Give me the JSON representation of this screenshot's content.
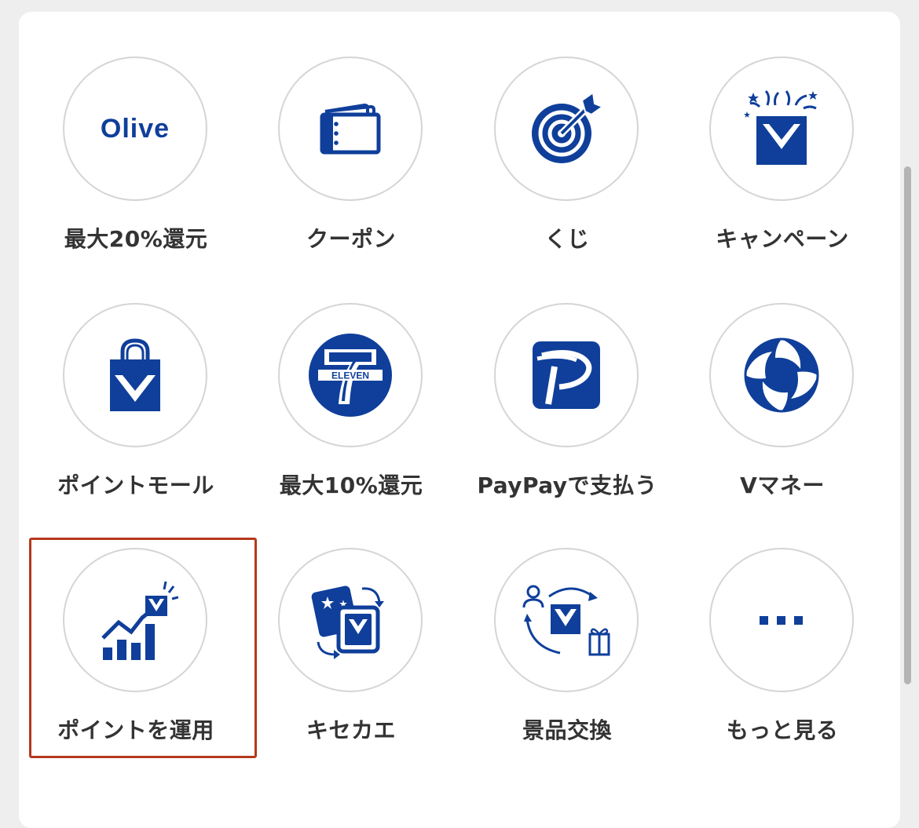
{
  "accent_color": "#0f3f9a",
  "highlight_color": "#b5381b",
  "menu": {
    "items": [
      {
        "label": "最大20%還元",
        "icon": "olive-logo-icon",
        "icon_text": "Olive"
      },
      {
        "label": "クーポン",
        "icon": "coupon-book-icon"
      },
      {
        "label": "くじ",
        "icon": "target-icon"
      },
      {
        "label": "キャンペーン",
        "icon": "celebration-envelope-icon"
      },
      {
        "label": "ポイントモール",
        "icon": "shopping-bag-icon"
      },
      {
        "label": "最大10%還元",
        "icon": "seven-eleven-icon",
        "icon_text": "ELEVEN"
      },
      {
        "label": "PayPayで支払う",
        "icon": "paypay-icon"
      },
      {
        "label": "Vマネー",
        "icon": "vmoney-icon"
      },
      {
        "label": "ポイントを運用",
        "icon": "investment-chart-icon",
        "selected": true
      },
      {
        "label": "キセカエ",
        "icon": "theme-cards-icon"
      },
      {
        "label": "景品交換",
        "icon": "prize-exchange-icon"
      },
      {
        "label": "もっと見る",
        "icon": "more-dots-icon"
      }
    ]
  }
}
